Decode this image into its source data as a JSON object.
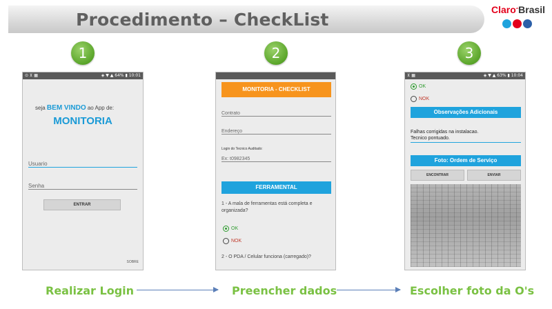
{
  "header": {
    "title": "Procedimento – CheckList"
  },
  "logo": {
    "text_a": "Claro",
    "text_b": "Brasil",
    "colors": [
      "#1fa3dd",
      "#e3001b",
      "#2b5fa8"
    ]
  },
  "steps": [
    {
      "number": "1",
      "caption": "Realizar Login"
    },
    {
      "number": "2",
      "caption": "Preencher dados"
    },
    {
      "number": "3",
      "caption": "Escolher foto da O's"
    }
  ],
  "phone1": {
    "status_left": "⊙ ⊻ ▦",
    "status_right": "◈ ▼ ▲ 64% ▮ 10:01",
    "welcome_prefix": "seja",
    "welcome_highlight": "BEM VINDO",
    "welcome_suffix": "ao App de:",
    "app_name": "MONITORIA",
    "user_placeholder": "Usuario",
    "password_placeholder": "Senha",
    "enter_button": "ENTRAR",
    "about_link": "SOBRE"
  },
  "phone2": {
    "header": "MONITORIA - CHECKLIST",
    "field_contract": "Contrato",
    "field_address": "Endereço",
    "tech_label": "Login do Tecnico Auditado:",
    "tech_placeholder": "Ex: t0982345",
    "section": "FERRAMENTAL",
    "question1": "1 - A mala de ferramentas está completa e organizada?",
    "ok": "OK",
    "nok": "NOK",
    "question2": "2 - O PDA / Celular funciona (carregado)?"
  },
  "phone3": {
    "status_left": "⊻ ▦",
    "status_right": "◈ ▼ ▲ 63% ▮ 10:04",
    "ok": "OK",
    "nok": "NOK",
    "obs_header": "Observações Adicionais",
    "obs_line1": "Falhas corrigidas na instalacao.",
    "obs_line2": "Tecnico pontuado.",
    "photo_header": "Foto: Ordem de Serviço",
    "find_button": "ENCONTRAR",
    "send_button": "ENVIAR"
  },
  "colors": {
    "green": "#7ac143",
    "blue": "#1fa3dd",
    "orange": "#f7941d"
  }
}
